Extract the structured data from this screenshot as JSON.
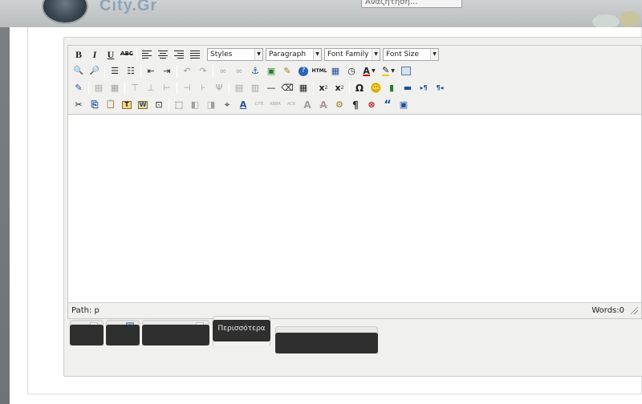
{
  "background": {
    "logo_text": "City.Gr",
    "search_text": "Αναζήτηση..."
  },
  "toolbar": {
    "row1": {
      "bold": "B",
      "italic": "I",
      "underline": "U",
      "strikethrough": "ABC",
      "styles_select": "Styles",
      "format_select": "Paragraph",
      "font_family_select": "Font Family",
      "font_size_select": "Font Size"
    },
    "row2": {
      "find": "🔍",
      "replace": "🔎",
      "unordered_list": "☰",
      "ordered_list": "☷",
      "outdent": "⇤",
      "indent": "⇥",
      "undo": "↶",
      "redo": "↷",
      "link": "∞",
      "unlink": "∞",
      "anchor": "⚓",
      "image": "▣",
      "cleanup": "✎",
      "help": "?",
      "html": "HTML",
      "insert_date": "▦",
      "insert_time": "◷",
      "forecolor": "A",
      "backcolor": "✎",
      "fullscreen": "▭"
    },
    "row3": {
      "edit_css": "✎",
      "row_props": "▤",
      "cell_props": "▦",
      "insert_row_before": "⊤",
      "insert_row_after": "⊥",
      "delete_row": "⊢",
      "insert_col_before": "⊣",
      "insert_col_after": "⊦",
      "delete_col": "Ψ",
      "split_cells": "▤",
      "merge_cells": "▥",
      "hr": "—",
      "remove_format": "⌫",
      "visual_aid": "▦",
      "subscript": "x",
      "subscript_mark": "2",
      "superscript": "x",
      "superscript_mark": "2",
      "charmap": "Ω",
      "emotions": "☺",
      "media": "▮",
      "advhr": "▬",
      "ltr": "▸¶",
      "rtl": "¶◂"
    },
    "row4": {
      "cut": "✂",
      "copy": "⎘",
      "paste": "📋",
      "paste_text": "T",
      "paste_word": "W",
      "select_all": "⊡",
      "insert_layer": "⬚",
      "move_forward": "◧",
      "move_backward": "◨",
      "absolute": "⌖",
      "styleprops": "A",
      "cite": "CITE",
      "abbr": "ABBR",
      "acronym": "ACR",
      "ins": "A",
      "del": "A",
      "attribs": "⚙",
      "visualchars": "¶",
      "nonbreaking": "⊗",
      "blockquote": "“",
      "template": "▣"
    }
  },
  "status": {
    "path": "Path: p",
    "words": "Words:0"
  },
  "tabs": {
    "tab4_label": "Περισσότερα"
  }
}
